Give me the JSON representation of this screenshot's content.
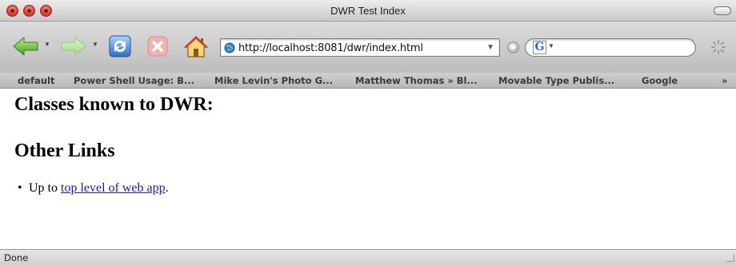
{
  "window": {
    "title": "DWR Test Index"
  },
  "toolbar": {
    "back_icon": "back-arrow-icon",
    "forward_icon": "forward-arrow-icon",
    "reload_icon": "reload-icon",
    "stop_icon": "stop-icon",
    "home_icon": "home-icon",
    "url": "http://localhost:8081/dwr/index.html",
    "search_engine_label": "G",
    "search_value": ""
  },
  "bookmarks": {
    "items": [
      "default",
      "Power Shell Usage: B...",
      "Mike Levin's Photo G...",
      "Matthew Thomas » Bl...",
      "Movable Type Publis...",
      "Google"
    ],
    "overflow": "»"
  },
  "page": {
    "heading_classes": "Classes known to DWR:",
    "heading_other": "Other Links",
    "list_prefix": "Up to ",
    "list_link": "top level of web app",
    "list_suffix": "."
  },
  "status": {
    "text": "Done"
  },
  "colors": {
    "link": "#1a1aa6",
    "traffic_red": "#e0443a"
  }
}
